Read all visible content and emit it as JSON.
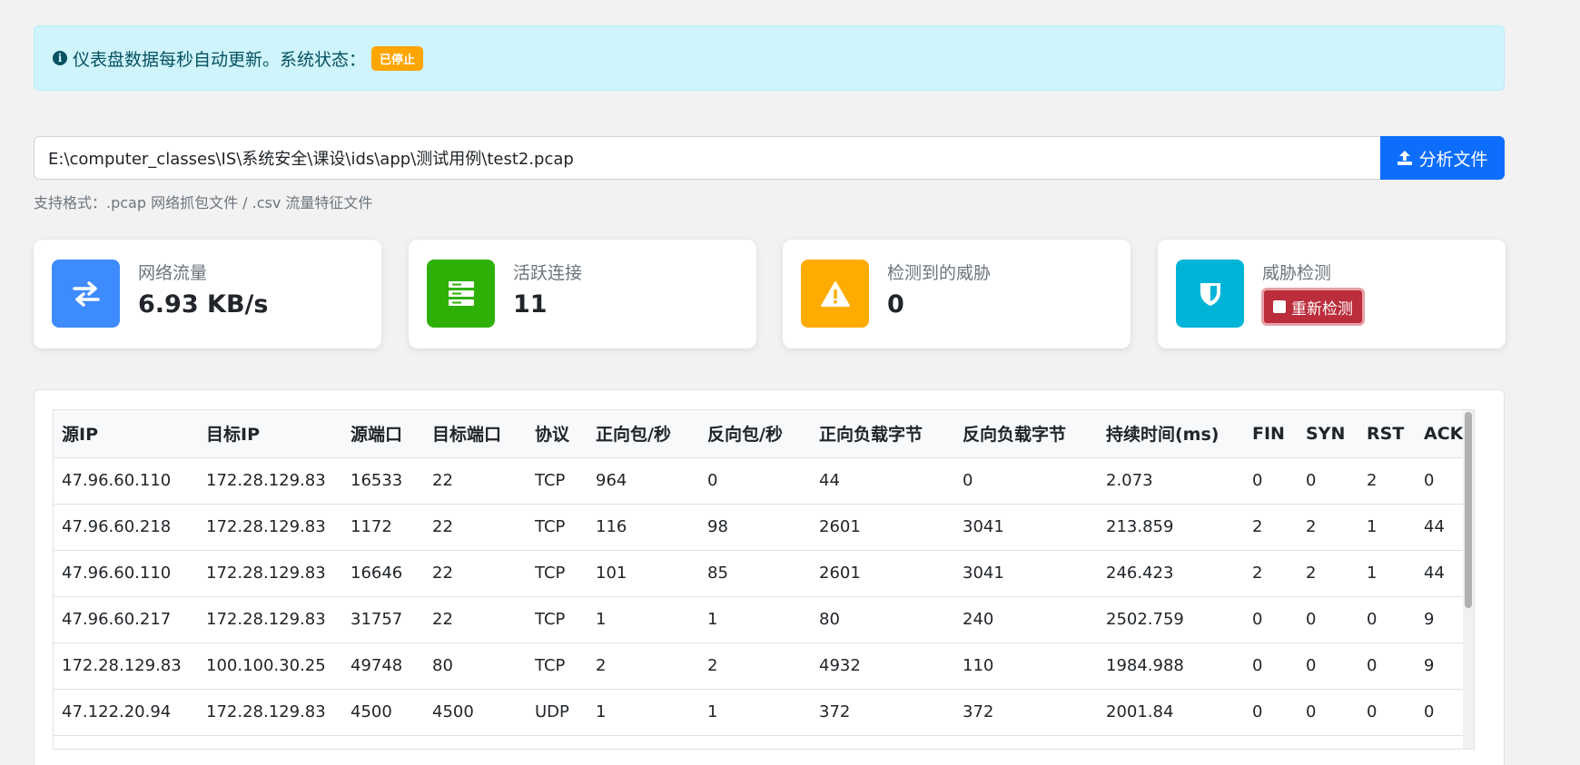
{
  "alert": {
    "text": "仪表盘数据每秒自动更新。系统状态：",
    "status_badge": "已停止"
  },
  "file": {
    "path": "E:\\computer_classes\\IS\\系统安全\\课设\\ids\\app\\测试用例\\test2.pcap",
    "analyze_label": "分析文件",
    "help": "支持格式：.pcap 网络抓包文件 / .csv 流量特征文件"
  },
  "cards": {
    "traffic": {
      "label": "网络流量",
      "value": "6.93 KB/s",
      "color": "#3d8bfd"
    },
    "connections": {
      "label": "活跃连接",
      "value": "11",
      "color": "#2fb006"
    },
    "threats": {
      "label": "检测到的威胁",
      "value": "0",
      "color": "#ffab00"
    },
    "detection": {
      "label": "威胁检测",
      "button": "重新检测",
      "color": "#00b4d8"
    }
  },
  "table": {
    "headers": [
      "源IP",
      "目标IP",
      "源端口",
      "目标端口",
      "协议",
      "正向包/秒",
      "反向包/秒",
      "正向负载字节",
      "反向负载字节",
      "持续时间(ms)",
      "FIN",
      "SYN",
      "RST",
      "ACK"
    ],
    "rows": [
      [
        "47.96.60.110",
        "172.28.129.83",
        "16533",
        "22",
        "TCP",
        "964",
        "0",
        "44",
        "0",
        "2.073",
        "0",
        "0",
        "2",
        "0"
      ],
      [
        "47.96.60.218",
        "172.28.129.83",
        "1172",
        "22",
        "TCP",
        "116",
        "98",
        "2601",
        "3041",
        "213.859",
        "2",
        "2",
        "1",
        "44"
      ],
      [
        "47.96.60.110",
        "172.28.129.83",
        "16646",
        "22",
        "TCP",
        "101",
        "85",
        "2601",
        "3041",
        "246.423",
        "2",
        "2",
        "1",
        "44"
      ],
      [
        "47.96.60.217",
        "172.28.129.83",
        "31757",
        "22",
        "TCP",
        "1",
        "1",
        "80",
        "240",
        "2502.759",
        "0",
        "0",
        "0",
        "9"
      ],
      [
        "172.28.129.83",
        "100.100.30.25",
        "49748",
        "80",
        "TCP",
        "2",
        "2",
        "4932",
        "110",
        "1984.988",
        "0",
        "0",
        "0",
        "9"
      ],
      [
        "47.122.20.94",
        "172.28.129.83",
        "4500",
        "4500",
        "UDP",
        "1",
        "1",
        "372",
        "372",
        "2001.84",
        "0",
        "0",
        "0",
        "0"
      ]
    ]
  }
}
